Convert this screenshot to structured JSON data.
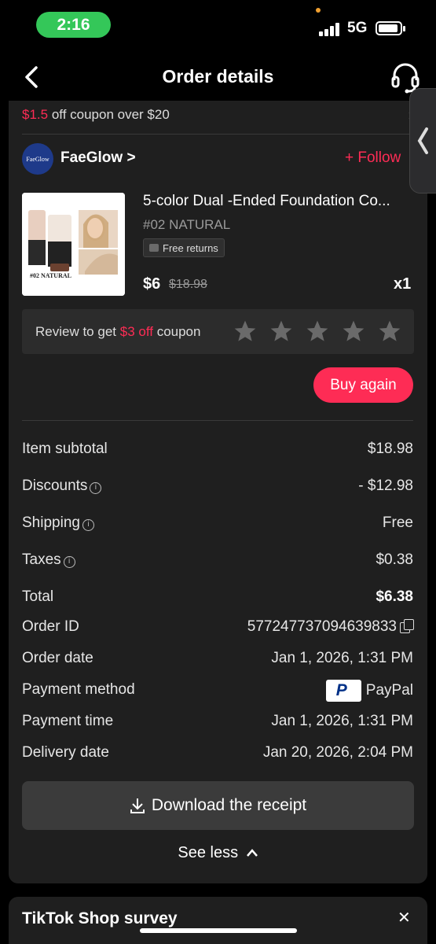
{
  "status_bar": {
    "time": "2:16",
    "network": "5G"
  },
  "header": {
    "title": "Order details"
  },
  "coupon": {
    "amount": "$1.5",
    "text": " off coupon over $20"
  },
  "shop": {
    "logo_text": "FaeGlow",
    "name": "FaeGlow",
    "name_chevron": ">",
    "follow_label": "+ Follow"
  },
  "product": {
    "title": "5-color Dual -Ended Foundation Co...",
    "variant": "#02 NATURAL",
    "image_caption": "#02 NATURAL",
    "badge": "Free returns",
    "price": "$6",
    "original_price": "$18.98",
    "quantity": "x1"
  },
  "review": {
    "prefix": "Review to get ",
    "amount": "$3 off",
    "suffix": " coupon",
    "stars": 5
  },
  "buy_again_label": "Buy again",
  "summary": [
    {
      "label": "Item subtotal",
      "value": "$18.98",
      "info": false,
      "bold": false
    },
    {
      "label": "Discounts",
      "value": "- $12.98",
      "info": true,
      "bold": false
    },
    {
      "label": "Shipping",
      "value": "Free",
      "info": true,
      "bold": false
    },
    {
      "label": "Taxes",
      "value": "$0.38",
      "info": true,
      "bold": false
    },
    {
      "label": "Total",
      "value": "$6.38",
      "info": false,
      "bold": true
    }
  ],
  "details": {
    "order_id_label": "Order ID",
    "order_id": "577247737094639833",
    "order_date_label": "Order date",
    "order_date": "Jan 1, 2026, 1:31 PM",
    "payment_method_label": "Payment method",
    "payment_method": "PayPal",
    "payment_time_label": "Payment time",
    "payment_time": "Jan 1, 2026, 1:31 PM",
    "delivery_date_label": "Delivery date",
    "delivery_date": "Jan 20, 2026, 2:04 PM"
  },
  "download_label": "Download the receipt",
  "see_less_label": "See less",
  "survey": {
    "title": "TikTok Shop survey"
  },
  "colors": {
    "accent": "#fe2c55",
    "status_green": "#34c759",
    "card_bg": "#1f1f1f"
  },
  "icons": [
    "back-arrow-icon",
    "headset-icon",
    "chevron-right-icon",
    "info-icon",
    "copy-icon",
    "paypal-icon",
    "download-icon",
    "chevron-up-icon",
    "close-icon",
    "star-icon"
  ]
}
